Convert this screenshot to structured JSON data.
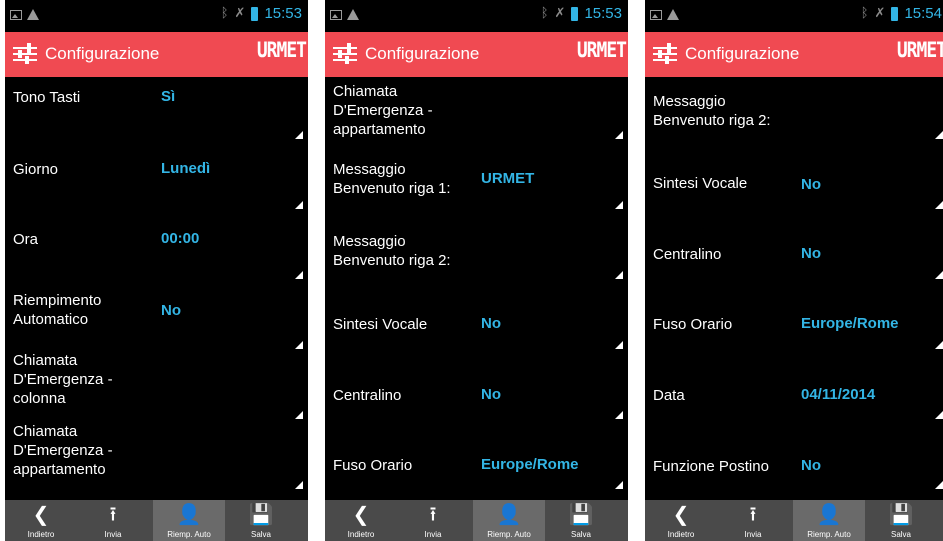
{
  "screens": [
    {
      "status": {
        "time": "15:53"
      },
      "header": {
        "title": "Configurazione",
        "logo": "URMET"
      },
      "rows": [
        {
          "label": "Tono Tasti",
          "value": "Sì"
        },
        {
          "label": "Giorno",
          "value": "Lunedì"
        },
        {
          "label": "Ora",
          "value": "00:00"
        },
        {
          "label": "Riempimento Automatico",
          "value": "No"
        },
        {
          "label": "Chiamata D'Emergenza - colonna",
          "value": ""
        },
        {
          "label": "Chiamata D'Emergenza - appartamento",
          "value": ""
        }
      ],
      "bottom": [
        {
          "label": "Indietro",
          "icon": "back-arrow-icon"
        },
        {
          "label": "Invia",
          "icon": "upload-icon"
        },
        {
          "label": "Riemp. Auto",
          "icon": "user-add-icon"
        },
        {
          "label": "Salva",
          "icon": "floppy-save-icon"
        }
      ]
    },
    {
      "status": {
        "time": "15:53"
      },
      "header": {
        "title": "Configurazione",
        "logo": "URMET"
      },
      "rows": [
        {
          "label": "Chiamata D'Emergenza - appartamento",
          "value": ""
        },
        {
          "label": "Messaggio Benvenuto riga 1:",
          "value": "URMET"
        },
        {
          "label": "Messaggio Benvenuto riga 2:",
          "value": ""
        },
        {
          "label": "Sintesi Vocale",
          "value": "No"
        },
        {
          "label": "Centralino",
          "value": "No"
        },
        {
          "label": "Fuso Orario",
          "value": "Europe/Rome"
        }
      ],
      "bottom": [
        {
          "label": "Indietro",
          "icon": "back-arrow-icon"
        },
        {
          "label": "Invia",
          "icon": "upload-icon"
        },
        {
          "label": "Riemp. Auto",
          "icon": "user-add-icon"
        },
        {
          "label": "Salva",
          "icon": "floppy-save-icon"
        }
      ]
    },
    {
      "status": {
        "time": "15:54"
      },
      "header": {
        "title": "Configurazione",
        "logo": "URMET"
      },
      "rows": [
        {
          "label": "Messaggio Benvenuto riga 2:",
          "value": ""
        },
        {
          "label": "Sintesi Vocale",
          "value": "No"
        },
        {
          "label": "Centralino",
          "value": "No"
        },
        {
          "label": "Fuso Orario",
          "value": "Europe/Rome"
        },
        {
          "label": "Data",
          "value": "04/11/2014"
        },
        {
          "label": "Funzione Postino",
          "value": "No"
        }
      ],
      "bottom": [
        {
          "label": "Indietro",
          "icon": "back-arrow-icon"
        },
        {
          "label": "Invia",
          "icon": "upload-icon"
        },
        {
          "label": "Riemp. Auto",
          "icon": "user-add-icon"
        },
        {
          "label": "Salva",
          "icon": "floppy-save-icon"
        }
      ]
    }
  ],
  "colors": {
    "actionbar": "#f04a52",
    "value": "#33b5e5",
    "background": "#000000",
    "bottombar": "#4a4a4a"
  }
}
